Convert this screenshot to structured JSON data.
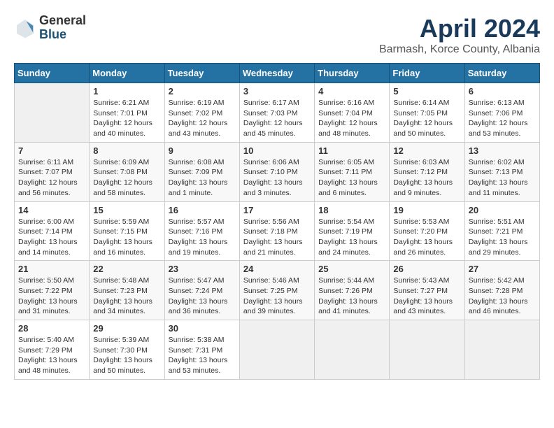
{
  "header": {
    "logo_general": "General",
    "logo_blue": "Blue",
    "title": "April 2024",
    "location": "Barmash, Korce County, Albania"
  },
  "days_of_week": [
    "Sunday",
    "Monday",
    "Tuesday",
    "Wednesday",
    "Thursday",
    "Friday",
    "Saturday"
  ],
  "weeks": [
    [
      {
        "day": "",
        "info": ""
      },
      {
        "day": "1",
        "info": "Sunrise: 6:21 AM\nSunset: 7:01 PM\nDaylight: 12 hours\nand 40 minutes."
      },
      {
        "day": "2",
        "info": "Sunrise: 6:19 AM\nSunset: 7:02 PM\nDaylight: 12 hours\nand 43 minutes."
      },
      {
        "day": "3",
        "info": "Sunrise: 6:17 AM\nSunset: 7:03 PM\nDaylight: 12 hours\nand 45 minutes."
      },
      {
        "day": "4",
        "info": "Sunrise: 6:16 AM\nSunset: 7:04 PM\nDaylight: 12 hours\nand 48 minutes."
      },
      {
        "day": "5",
        "info": "Sunrise: 6:14 AM\nSunset: 7:05 PM\nDaylight: 12 hours\nand 50 minutes."
      },
      {
        "day": "6",
        "info": "Sunrise: 6:13 AM\nSunset: 7:06 PM\nDaylight: 12 hours\nand 53 minutes."
      }
    ],
    [
      {
        "day": "7",
        "info": "Sunrise: 6:11 AM\nSunset: 7:07 PM\nDaylight: 12 hours\nand 56 minutes."
      },
      {
        "day": "8",
        "info": "Sunrise: 6:09 AM\nSunset: 7:08 PM\nDaylight: 12 hours\nand 58 minutes."
      },
      {
        "day": "9",
        "info": "Sunrise: 6:08 AM\nSunset: 7:09 PM\nDaylight: 13 hours\nand 1 minute."
      },
      {
        "day": "10",
        "info": "Sunrise: 6:06 AM\nSunset: 7:10 PM\nDaylight: 13 hours\nand 3 minutes."
      },
      {
        "day": "11",
        "info": "Sunrise: 6:05 AM\nSunset: 7:11 PM\nDaylight: 13 hours\nand 6 minutes."
      },
      {
        "day": "12",
        "info": "Sunrise: 6:03 AM\nSunset: 7:12 PM\nDaylight: 13 hours\nand 9 minutes."
      },
      {
        "day": "13",
        "info": "Sunrise: 6:02 AM\nSunset: 7:13 PM\nDaylight: 13 hours\nand 11 minutes."
      }
    ],
    [
      {
        "day": "14",
        "info": "Sunrise: 6:00 AM\nSunset: 7:14 PM\nDaylight: 13 hours\nand 14 minutes."
      },
      {
        "day": "15",
        "info": "Sunrise: 5:59 AM\nSunset: 7:15 PM\nDaylight: 13 hours\nand 16 minutes."
      },
      {
        "day": "16",
        "info": "Sunrise: 5:57 AM\nSunset: 7:16 PM\nDaylight: 13 hours\nand 19 minutes."
      },
      {
        "day": "17",
        "info": "Sunrise: 5:56 AM\nSunset: 7:18 PM\nDaylight: 13 hours\nand 21 minutes."
      },
      {
        "day": "18",
        "info": "Sunrise: 5:54 AM\nSunset: 7:19 PM\nDaylight: 13 hours\nand 24 minutes."
      },
      {
        "day": "19",
        "info": "Sunrise: 5:53 AM\nSunset: 7:20 PM\nDaylight: 13 hours\nand 26 minutes."
      },
      {
        "day": "20",
        "info": "Sunrise: 5:51 AM\nSunset: 7:21 PM\nDaylight: 13 hours\nand 29 minutes."
      }
    ],
    [
      {
        "day": "21",
        "info": "Sunrise: 5:50 AM\nSunset: 7:22 PM\nDaylight: 13 hours\nand 31 minutes."
      },
      {
        "day": "22",
        "info": "Sunrise: 5:48 AM\nSunset: 7:23 PM\nDaylight: 13 hours\nand 34 minutes."
      },
      {
        "day": "23",
        "info": "Sunrise: 5:47 AM\nSunset: 7:24 PM\nDaylight: 13 hours\nand 36 minutes."
      },
      {
        "day": "24",
        "info": "Sunrise: 5:46 AM\nSunset: 7:25 PM\nDaylight: 13 hours\nand 39 minutes."
      },
      {
        "day": "25",
        "info": "Sunrise: 5:44 AM\nSunset: 7:26 PM\nDaylight: 13 hours\nand 41 minutes."
      },
      {
        "day": "26",
        "info": "Sunrise: 5:43 AM\nSunset: 7:27 PM\nDaylight: 13 hours\nand 43 minutes."
      },
      {
        "day": "27",
        "info": "Sunrise: 5:42 AM\nSunset: 7:28 PM\nDaylight: 13 hours\nand 46 minutes."
      }
    ],
    [
      {
        "day": "28",
        "info": "Sunrise: 5:40 AM\nSunset: 7:29 PM\nDaylight: 13 hours\nand 48 minutes."
      },
      {
        "day": "29",
        "info": "Sunrise: 5:39 AM\nSunset: 7:30 PM\nDaylight: 13 hours\nand 50 minutes."
      },
      {
        "day": "30",
        "info": "Sunrise: 5:38 AM\nSunset: 7:31 PM\nDaylight: 13 hours\nand 53 minutes."
      },
      {
        "day": "",
        "info": ""
      },
      {
        "day": "",
        "info": ""
      },
      {
        "day": "",
        "info": ""
      },
      {
        "day": "",
        "info": ""
      }
    ]
  ]
}
